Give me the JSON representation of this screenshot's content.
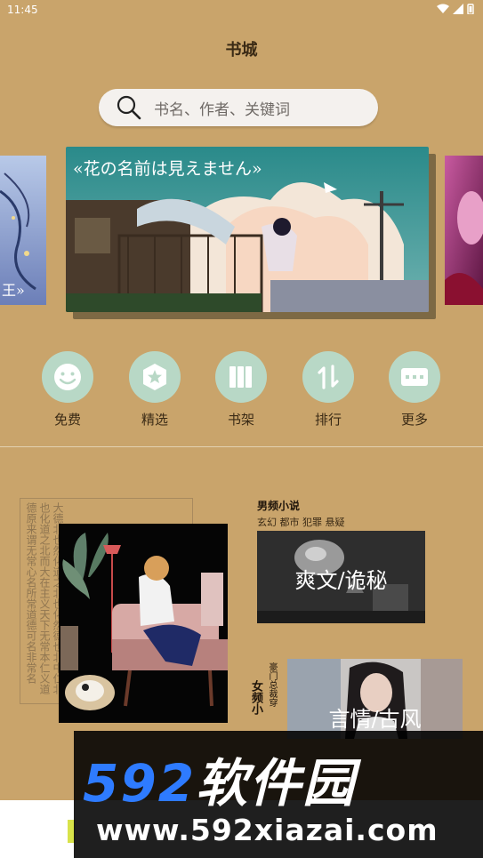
{
  "status": {
    "time": "11:45"
  },
  "header": {
    "title": "书城"
  },
  "search": {
    "placeholder": "书名、作者、关键词"
  },
  "banner": {
    "caption": "«花の名前は見えません»",
    "left_caption": "王»"
  },
  "menu": [
    {
      "label": "免费",
      "icon": "smile-icon"
    },
    {
      "label": "精选",
      "icon": "star-badge-icon"
    },
    {
      "label": "书架",
      "icon": "bookshelf-icon"
    },
    {
      "label": "排行",
      "icon": "sort-arrows-icon"
    },
    {
      "label": "更多",
      "icon": "more-dots-icon"
    }
  ],
  "poem_text": "大德北也然化道之北也化然德也北中仁北也化道之北而大在主义天下无常本仁义道德原来谓无常心名所常道德可名非常名",
  "male": {
    "heading": "男频小说",
    "tags": "玄幻 都市 犯罪 悬疑",
    "image_title": "爽文/诡秘"
  },
  "female": {
    "heading": "女频小",
    "tags": "豪门总裁穿",
    "image_title": "言情/古风"
  },
  "watermark": {
    "num": "592",
    "cn": "软件园",
    "url": "www.592xiazai.com"
  },
  "colors": {
    "background": "#c9a46b",
    "menu_circle": "#b8d8c6",
    "watermark_blue": "#2e7bff"
  }
}
